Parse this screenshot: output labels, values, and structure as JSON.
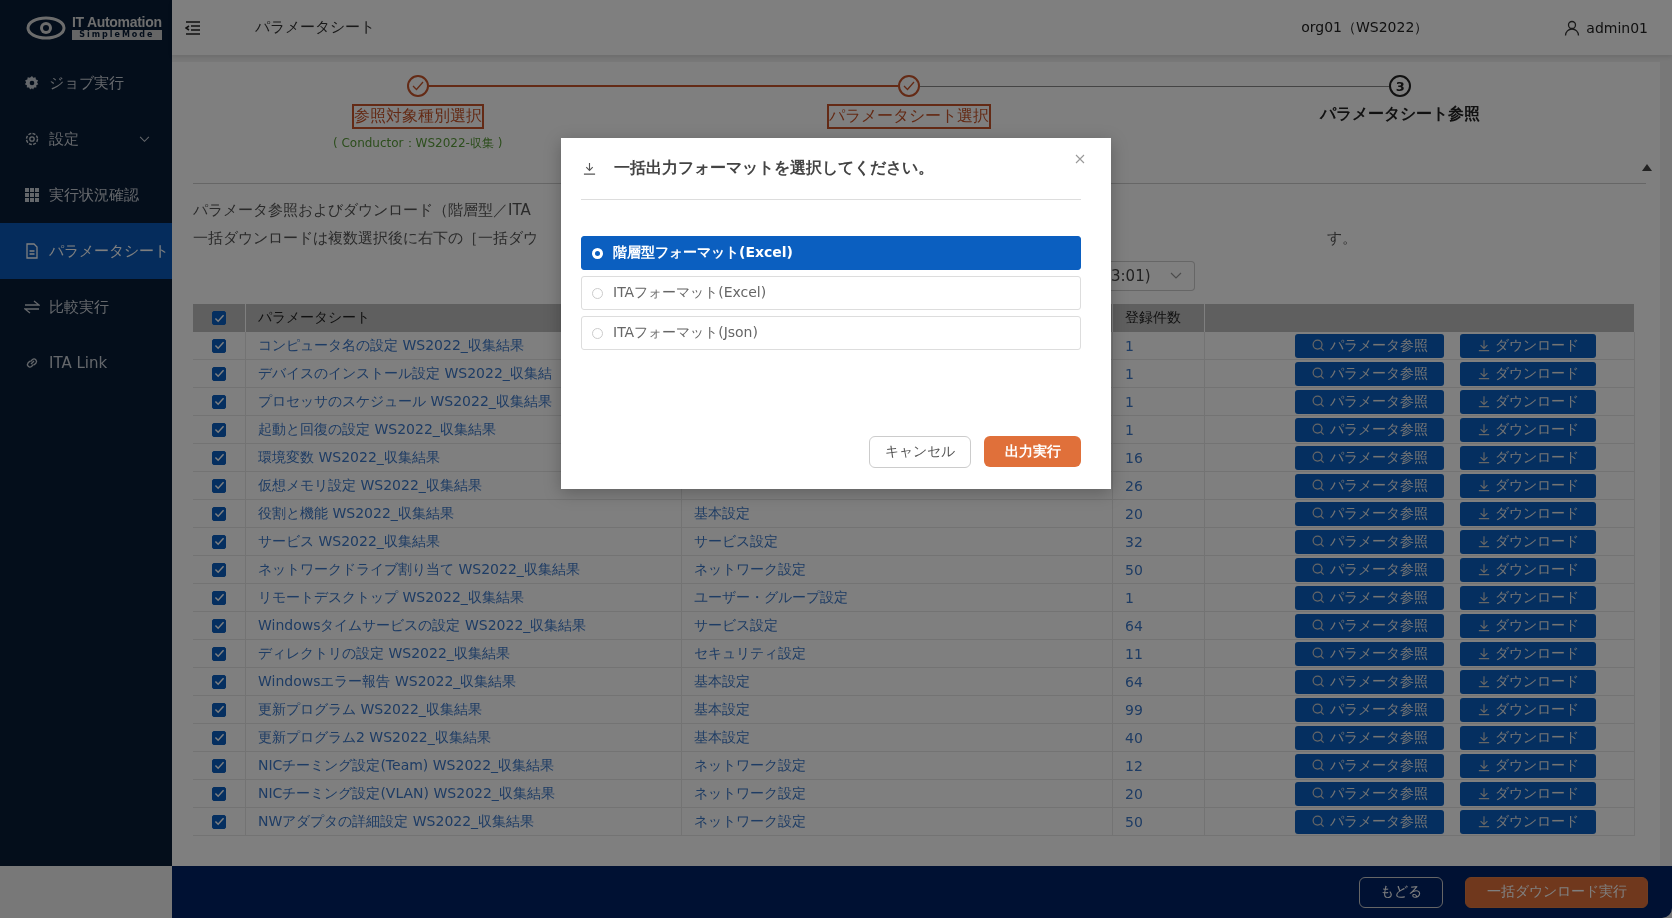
{
  "logo": {
    "name": "IT Automation",
    "sub": "SimpleMode"
  },
  "sidebar": {
    "items": [
      {
        "label": "ジョブ実行",
        "kind": "link",
        "selected": false
      },
      {
        "label": "設定",
        "kind": "group",
        "selected": false
      },
      {
        "label": "実行状況確認",
        "kind": "link",
        "selected": false
      },
      {
        "label": "パラメータシート",
        "kind": "link",
        "selected": true
      },
      {
        "label": "比較実行",
        "kind": "link",
        "selected": false
      },
      {
        "label": "ITA Link",
        "kind": "link",
        "selected": false
      }
    ]
  },
  "header": {
    "title": "パラメータシート",
    "org": "org01（WS2022）",
    "user": "admin01"
  },
  "steps": [
    {
      "label": "参照対象種別選択",
      "sub": "( Conductor：WS2022-収集 )",
      "done": true
    },
    {
      "label": "パラメータシート選択",
      "done": true
    },
    {
      "label": "パラメータシート参照",
      "number": "3",
      "done": false
    }
  ],
  "intro": {
    "lines": [
      "パラメータ参照およびダウンロード（階層型／ITA",
      "一括ダウンロードは複数選択後に右下の［一括ダウ"
    ],
    "tail": "す。"
  },
  "version_select": {
    "value": "3:01)"
  },
  "table": {
    "all_checked": true,
    "name_heading": "パラメータシート",
    "count_heading": "登録件数",
    "rows": [
      {
        "checked": true,
        "name": "コンピュータ名の設定 WS2022_収集結果",
        "count": "1",
        "view_button": "パラメータ参照",
        "download_button": "ダウンロード"
      },
      {
        "checked": true,
        "name": "デバイスのインストール設定 WS2022_収集結",
        "count": "1",
        "view_button": "パラメータ参照",
        "download_button": "ダウンロード"
      },
      {
        "checked": true,
        "name": "プロセッサのスケジュール WS2022_収集結果",
        "count": "1",
        "view_button": "パラメータ参照",
        "download_button": "ダウンロード"
      },
      {
        "checked": true,
        "name": "起動と回復の設定 WS2022_収集結果",
        "count": "1",
        "view_button": "パラメータ参照",
        "download_button": "ダウンロード"
      },
      {
        "checked": true,
        "name": "環境変数 WS2022_収集結果",
        "count": "16",
        "view_button": "パラメータ参照",
        "download_button": "ダウンロード"
      },
      {
        "checked": true,
        "name": "仮想メモリ設定 WS2022_収集結果",
        "count": "26",
        "view_button": "パラメータ参照",
        "download_button": "ダウンロード"
      },
      {
        "checked": true,
        "name": "役割と機能 WS2022_収集結果",
        "category": "基本設定",
        "count": "20",
        "view_button": "パラメータ参照",
        "download_button": "ダウンロード"
      },
      {
        "checked": true,
        "name": "サービス WS2022_収集結果",
        "category": "サービス設定",
        "count": "32",
        "view_button": "パラメータ参照",
        "download_button": "ダウンロード"
      },
      {
        "checked": true,
        "name": "ネットワークドライブ割り当て WS2022_収集結果",
        "category": "ネットワーク設定",
        "count": "50",
        "view_button": "パラメータ参照",
        "download_button": "ダウンロード"
      },
      {
        "checked": true,
        "name": "リモートデスクトップ WS2022_収集結果",
        "category": "ユーザー・グループ設定",
        "count": "1",
        "view_button": "パラメータ参照",
        "download_button": "ダウンロード"
      },
      {
        "checked": true,
        "name": "Windowsタイムサービスの設定 WS2022_収集結果",
        "category": "サービス設定",
        "count": "64",
        "view_button": "パラメータ参照",
        "download_button": "ダウンロード"
      },
      {
        "checked": true,
        "name": "ディレクトリの設定 WS2022_収集結果",
        "category": "セキュリティ設定",
        "count": "11",
        "view_button": "パラメータ参照",
        "download_button": "ダウンロード"
      },
      {
        "checked": true,
        "name": "Windowsエラー報告 WS2022_収集結果",
        "category": "基本設定",
        "count": "64",
        "view_button": "パラメータ参照",
        "download_button": "ダウンロード"
      },
      {
        "checked": true,
        "name": "更新プログラム WS2022_収集結果",
        "category": "基本設定",
        "count": "99",
        "view_button": "パラメータ参照",
        "download_button": "ダウンロード"
      },
      {
        "checked": true,
        "name": "更新プログラム2 WS2022_収集結果",
        "category": "基本設定",
        "count": "40",
        "view_button": "パラメータ参照",
        "download_button": "ダウンロード"
      },
      {
        "checked": true,
        "name": "NICチーミング設定(Team) WS2022_収集結果",
        "category": "ネットワーク設定",
        "count": "12",
        "view_button": "パラメータ参照",
        "download_button": "ダウンロード"
      },
      {
        "checked": true,
        "name": "NICチーミング設定(VLAN) WS2022_収集結果",
        "category": "ネットワーク設定",
        "count": "20",
        "view_button": "パラメータ参照",
        "download_button": "ダウンロード"
      },
      {
        "checked": true,
        "name": "NWアダプタの詳細設定 WS2022_収集結果",
        "category": "ネットワーク設定",
        "count": "50",
        "view_button": "パラメータ参照",
        "download_button": "ダウンロード"
      }
    ]
  },
  "footer": {
    "back": "もどる",
    "bulk": "一括ダウンロード実行"
  },
  "modal": {
    "title": "一括出力フォーマットを選択してください。",
    "options": [
      {
        "label": "階層型フォーマット(Excel)",
        "selected": true
      },
      {
        "label": "ITAフォーマット(Excel)",
        "selected": false
      },
      {
        "label": "ITAフォーマット(Json)",
        "selected": false
      }
    ],
    "cancel": "キャンセル",
    "confirm": "出力実行"
  }
}
